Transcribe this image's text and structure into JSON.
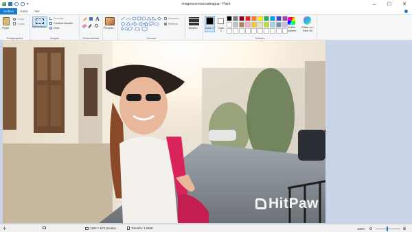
{
  "window": {
    "title": "imagenconmarcadeagua - Paint"
  },
  "tabs": [
    {
      "label": "Archivo"
    },
    {
      "label": "Inicio"
    },
    {
      "label": "Ver"
    }
  ],
  "ribbon": {
    "clipboard": {
      "paste": "Pegar",
      "cut": "Cortar",
      "copy": "Copiar",
      "group": "Portapapeles"
    },
    "image": {
      "select": "Seleccionar",
      "crop": "Recortar",
      "resize": "Cambiar tamaño",
      "rotate": "Girar",
      "group": "Imagen"
    },
    "tools": {
      "group": "Herramientas"
    },
    "brushes": {
      "label": "Pinceles"
    },
    "shapes": {
      "outline": "Contorno",
      "fill": "Rellenar",
      "group": "Formas"
    },
    "size": {
      "label": "Tamaño"
    },
    "colors": {
      "color1": "Color 1",
      "color2": "Color 2",
      "edit": "Editar colores",
      "paint3d": "Editar con Paint 3D",
      "group": "Colores"
    }
  },
  "palette_row1": [
    "#000000",
    "#7f7f7f",
    "#880015",
    "#ed1c24",
    "#ff7f27",
    "#fff200",
    "#22b14c",
    "#00a2e8",
    "#3f48cc",
    "#a349a4"
  ],
  "palette_row2": [
    "#ffffff",
    "#c3c3c3",
    "#b97a57",
    "#ffaec9",
    "#ffc90e",
    "#efe4b0",
    "#b5e61d",
    "#99d9ea",
    "#7092be",
    "#c8bfe7"
  ],
  "watermark": {
    "text": "HitPaw"
  },
  "status": {
    "dimensions": "1190 × 674 píxeles",
    "size": "Tamaño: 1,5MB",
    "zoom": "100%"
  }
}
